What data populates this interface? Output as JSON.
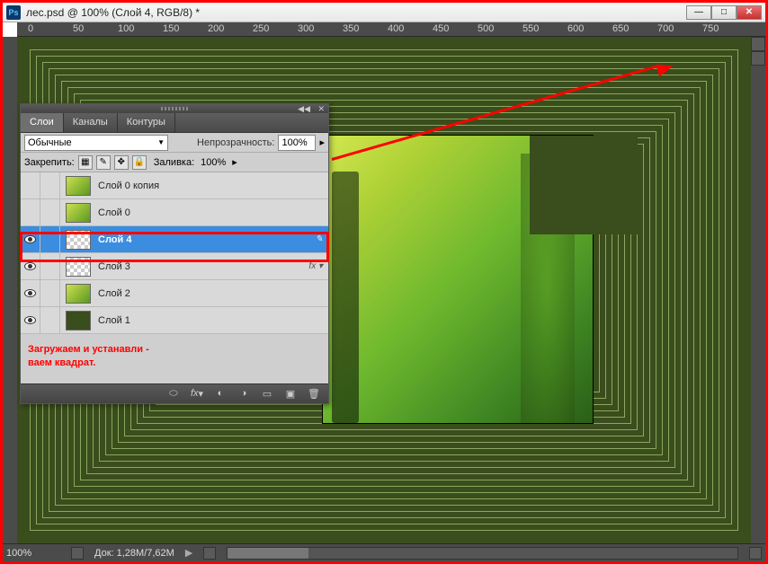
{
  "window": {
    "title": "лес.psd @ 100% (Слой 4, RGB/8) *",
    "ps_badge": "Ps"
  },
  "ruler_marks": [
    "0",
    "50",
    "100",
    "150",
    "200",
    "250",
    "300",
    "350",
    "400",
    "450",
    "500",
    "550",
    "600",
    "650",
    "700",
    "750"
  ],
  "status": {
    "zoom": "100%",
    "doc": "Док: 1,28M/7,62M"
  },
  "layers_panel": {
    "tabs": [
      "Слои",
      "Каналы",
      "Контуры"
    ],
    "active_tab": 0,
    "blend_mode": "Обычные",
    "opacity_label": "Непрозрачность:",
    "opacity_value": "100%",
    "lock_label": "Закрепить:",
    "fill_label": "Заливка:",
    "fill_value": "100%",
    "layers": [
      {
        "name": "Слой 0 копия",
        "visible": false,
        "thumb": "forest",
        "active": false,
        "fx": false
      },
      {
        "name": "Слой 0",
        "visible": false,
        "thumb": "forest",
        "active": false,
        "fx": false
      },
      {
        "name": "Слой 4",
        "visible": true,
        "thumb": "checker",
        "active": true,
        "fx": false
      },
      {
        "name": "Слой 3",
        "visible": true,
        "thumb": "checker",
        "active": false,
        "fx": true
      },
      {
        "name": "Слой 2",
        "visible": true,
        "thumb": "forest",
        "active": false,
        "fx": false
      },
      {
        "name": "Слой 1",
        "visible": true,
        "thumb": "green",
        "active": false,
        "fx": false
      }
    ],
    "annotation_line1": "Загружаем и устанавли -",
    "annotation_line2": "ваем квадрат.",
    "fx_label": "fx",
    "bottom_icons": [
      "link-icon",
      "fx-icon",
      "mask-icon",
      "fill-adj-icon",
      "group-icon",
      "new-layer-icon",
      "trash-icon"
    ]
  }
}
